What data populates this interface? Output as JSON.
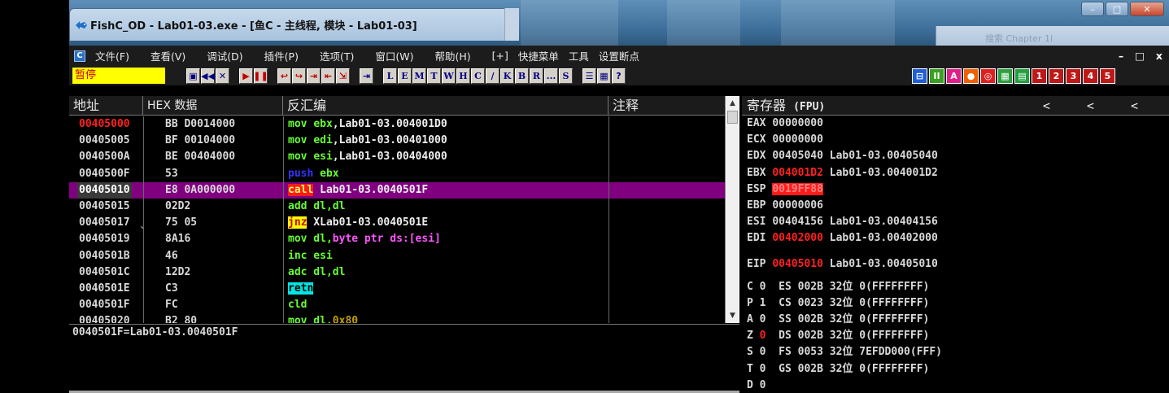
{
  "window": {
    "title": "FishC_OD - Lab01-03.exe - [鱼C - 主线程, 模块 - Lab01-03]",
    "bg_title_fragment": "Chapter 1l",
    "bg_search_fragment": "搜索 Chapter 1l"
  },
  "menu": {
    "items": [
      "文件(F)",
      "查看(V)",
      "调试(D)",
      "插件(P)",
      "选项(T)",
      "窗口(W)",
      "帮助(H)",
      "[+]",
      "快捷菜单",
      "工具",
      "设置断点"
    ],
    "mdi_controls": [
      "–",
      "□",
      "x"
    ]
  },
  "toolbar": {
    "status": "暂停",
    "group1": [
      "▣",
      "◀◀",
      "✕"
    ],
    "group2": [
      "▶",
      "❚❚"
    ],
    "group3": [
      "↩",
      "↪",
      "⇥",
      "⇤",
      "⇲"
    ],
    "group4": [
      "⇥"
    ],
    "letters": [
      "L",
      "E",
      "M",
      "T",
      "W",
      "H",
      "C",
      "/",
      "K",
      "B",
      "R",
      "...",
      "S"
    ],
    "group5": [
      "☰",
      "▦",
      "?"
    ],
    "color_buttons": [
      {
        "label": "⊟",
        "color": "#1f5fd6"
      },
      {
        "label": "II",
        "color": "#3aa020"
      },
      {
        "label": "A",
        "color": "#e0208a"
      },
      {
        "label": "●",
        "color": "#f06000"
      },
      {
        "label": "◎",
        "color": "#e02020"
      },
      {
        "label": "▦",
        "color": "#2aa040"
      },
      {
        "label": "▤",
        "color": "#20a040"
      },
      {
        "label": "1",
        "color": "#c01818"
      },
      {
        "label": "2",
        "color": "#c01818"
      },
      {
        "label": "3",
        "color": "#c01818"
      },
      {
        "label": "4",
        "color": "#c01818"
      },
      {
        "label": "5",
        "color": "#c01818"
      }
    ]
  },
  "cpu": {
    "headers": {
      "addr": "地址",
      "hex": "HEX 数据",
      "disasm": "反汇编",
      "comment": "注释"
    },
    "rows": [
      {
        "addr": "00405000",
        "hex": "BB D0014000",
        "jmp": "",
        "addr_style": "red",
        "sel": false,
        "dis": [
          {
            "t": "mov ",
            "c": "tok-green"
          },
          {
            "t": "ebx",
            "c": "tok-green"
          },
          {
            "t": ",Lab01-03.004001D0",
            "c": "tok-white"
          }
        ]
      },
      {
        "addr": "00405005",
        "hex": "BF 00104000",
        "jmp": "",
        "addr_style": "",
        "sel": false,
        "dis": [
          {
            "t": "mov ",
            "c": "tok-green"
          },
          {
            "t": "edi",
            "c": "tok-green"
          },
          {
            "t": ",Lab01-03.00401000",
            "c": "tok-white"
          }
        ]
      },
      {
        "addr": "0040500A",
        "hex": "BE 00404000",
        "jmp": "",
        "addr_style": "",
        "sel": false,
        "dis": [
          {
            "t": "mov ",
            "c": "tok-green"
          },
          {
            "t": "esi",
            "c": "tok-green"
          },
          {
            "t": ",Lab01-03.00404000",
            "c": "tok-white"
          }
        ]
      },
      {
        "addr": "0040500F",
        "hex": "53",
        "jmp": "",
        "addr_style": "",
        "sel": false,
        "dis": [
          {
            "t": "push",
            "c": "tok-blue"
          },
          {
            "t": " ebx",
            "c": "tok-green"
          }
        ]
      },
      {
        "addr": "00405010",
        "hex": "E8 0A000000",
        "jmp": "",
        "addr_style": "hl",
        "sel": true,
        "dis": [
          {
            "t": "call",
            "c": "tok-red-bg"
          },
          {
            "t": " Lab01-03.0040501F",
            "c": "tok-white"
          }
        ]
      },
      {
        "addr": "00405015",
        "hex": "02D2",
        "jmp": "",
        "addr_style": "",
        "sel": false,
        "dis": [
          {
            "t": "add dl,dl",
            "c": "tok-green"
          }
        ]
      },
      {
        "addr": "00405017",
        "hex": "75 05",
        "jmp": "⌄",
        "addr_style": "",
        "sel": false,
        "dis": [
          {
            "t": "jnz",
            "c": "tok-yellow-bg"
          },
          {
            "t": " XLab01-03.0040501E",
            "c": "tok-white"
          }
        ]
      },
      {
        "addr": "00405019",
        "hex": "8A16",
        "jmp": "",
        "addr_style": "",
        "sel": false,
        "dis": [
          {
            "t": "mov dl,",
            "c": "tok-green"
          },
          {
            "t": "byte ptr ds:[esi]",
            "c": "tok-magenta"
          }
        ]
      },
      {
        "addr": "0040501B",
        "hex": "46",
        "jmp": "",
        "addr_style": "",
        "sel": false,
        "dis": [
          {
            "t": "inc esi",
            "c": "tok-green"
          }
        ]
      },
      {
        "addr": "0040501C",
        "hex": "12D2",
        "jmp": "",
        "addr_style": "",
        "sel": false,
        "dis": [
          {
            "t": "adc dl,dl",
            "c": "tok-green"
          }
        ]
      },
      {
        "addr": "0040501E",
        "hex": "C3",
        "jmp": "",
        "addr_style": "",
        "sel": false,
        "dis": [
          {
            "t": "retn",
            "c": "tok-cyan-bg"
          }
        ]
      },
      {
        "addr": "0040501F",
        "hex": "FC",
        "jmp": "",
        "addr_style": "",
        "sel": false,
        "dis": [
          {
            "t": "cld",
            "c": "tok-green"
          }
        ]
      },
      {
        "addr": "00405020",
        "hex": "B2 80",
        "jmp": "",
        "addr_style": "",
        "sel": false,
        "dis": [
          {
            "t": "mov dl,",
            "c": "tok-green"
          },
          {
            "t": "0x80",
            "c": "tok-olive"
          }
        ]
      }
    ]
  },
  "info": {
    "text": "0040501F=Lab01-03.0040501F"
  },
  "registers": {
    "header": "寄存器",
    "header_suffix": "(FPU)",
    "nav": [
      "<",
      "<",
      "<"
    ],
    "lines": [
      {
        "name": "EAX",
        "value": "00000000",
        "value_style": "",
        "comment": ""
      },
      {
        "name": "ECX",
        "value": "00000000",
        "value_style": "",
        "comment": ""
      },
      {
        "name": "EDX",
        "value": "00405040",
        "value_style": "",
        "comment": "Lab01-03.00405040"
      },
      {
        "name": "EBX",
        "value": "004001D2",
        "value_style": "redv",
        "comment": "Lab01-03.004001D2"
      },
      {
        "name": "ESP",
        "value": "0019FF88",
        "value_style": "redbg",
        "comment": ""
      },
      {
        "name": "EBP",
        "value": "00000006",
        "value_style": "",
        "comment": ""
      },
      {
        "name": "ESI",
        "value": "00404156",
        "value_style": "",
        "comment": "Lab01-03.00404156"
      },
      {
        "name": "EDI",
        "value": "00402000",
        "value_style": "redv",
        "comment": "Lab01-03.00402000"
      }
    ],
    "eip": {
      "name": "EIP",
      "value": "00405010",
      "comment": "Lab01-03.00405010"
    },
    "segments": [
      {
        "flag": "C",
        "bit": "0",
        "bit_red": false,
        "seg": "ES",
        "sel": "002B",
        "bits": "32位",
        "base": "0(FFFFFFFF)"
      },
      {
        "flag": "P",
        "bit": "1",
        "bit_red": false,
        "seg": "CS",
        "sel": "0023",
        "bits": "32位",
        "base": "0(FFFFFFFF)"
      },
      {
        "flag": "A",
        "bit": "0",
        "bit_red": false,
        "seg": "SS",
        "sel": "002B",
        "bits": "32位",
        "base": "0(FFFFFFFF)"
      },
      {
        "flag": "Z",
        "bit": "0",
        "bit_red": true,
        "seg": "DS",
        "sel": "002B",
        "bits": "32位",
        "base": "0(FFFFFFFF)"
      },
      {
        "flag": "S",
        "bit": "0",
        "bit_red": false,
        "seg": "FS",
        "sel": "0053",
        "bits": "32位",
        "base": "7EFDD000(FFF)"
      },
      {
        "flag": "T",
        "bit": "0",
        "bit_red": false,
        "seg": "GS",
        "sel": "002B",
        "bits": "32位",
        "base": "0(FFFFFFFF)"
      },
      {
        "flag": "D",
        "bit": "0",
        "bit_red": false,
        "seg": "",
        "sel": "",
        "bits": "",
        "base": ""
      }
    ]
  },
  "colors": {
    "selection": "#800080",
    "status_bg": "#ffff00",
    "status_fg": "#cc0000",
    "changed_value": "#ff2020"
  }
}
